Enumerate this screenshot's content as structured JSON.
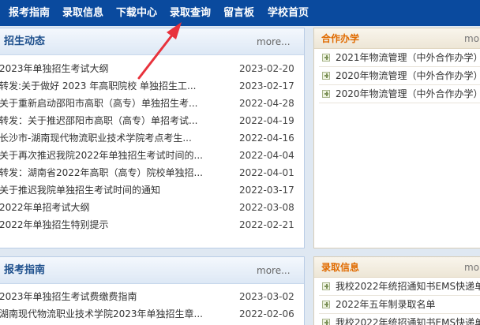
{
  "nav": {
    "items": [
      "报考指南",
      "录取信息",
      "下载中心",
      "录取查询",
      "留言板",
      "学校首页"
    ]
  },
  "admissions_news": {
    "title": "招生动态",
    "more": "more...",
    "rows": [
      {
        "title": "2023年单独招生考试大纲",
        "date": "2023-02-20"
      },
      {
        "title": "转发:关于做好 2023 年高职院校 单独招生工...",
        "date": "2023-02-17"
      },
      {
        "title": "关于重新启动邵阳市高职（高专）单独招生考...",
        "date": "2022-04-28"
      },
      {
        "title": "转发：关于推迟邵阳市高职（高专）单招考试...",
        "date": "2022-04-19"
      },
      {
        "title": "长沙市-湖南现代物流职业技术学院考点考生...",
        "date": "2022-04-16"
      },
      {
        "title": "关于再次推迟我院2022年单独招生考试时间的...",
        "date": "2022-04-04"
      },
      {
        "title": "转发：湖南省2022年高职（高专）院校单独招...",
        "date": "2022-04-01"
      },
      {
        "title": "关于推迟我院单独招生考试时间的通知",
        "date": "2022-03-17"
      },
      {
        "title": "2022年单招考试大纲",
        "date": "2022-03-08"
      },
      {
        "title": "2022年单独招生特别提示",
        "date": "2022-02-21"
      }
    ]
  },
  "exam_guide": {
    "title": "报考指南",
    "more": "more...",
    "rows": [
      {
        "title": "2023年单独招生考试费缴费指南",
        "date": "2023-03-02"
      },
      {
        "title": "湖南现代物流职业技术学院2023年单独招生章...",
        "date": "2022-02-06"
      }
    ]
  },
  "cooperation": {
    "title": "合作办学",
    "more": "more",
    "items": [
      "2021年物流管理（中外合作办学）",
      "2020年物流管理（中外合作办学）",
      "2020年物流管理（中外合作办学）"
    ]
  },
  "admission_info": {
    "title": "录取信息",
    "more": "more",
    "items": [
      "我校2022年统招通知书EMS快递单",
      "2022年五年制录取名单",
      "我校2022年统招通知书EMS快递单"
    ]
  },
  "colors": {
    "nav_bg": "#0a4a9e",
    "panel_title": "#1d4f8c",
    "side_title": "#e06b00",
    "annotation_arrow": "#e8323c"
  }
}
